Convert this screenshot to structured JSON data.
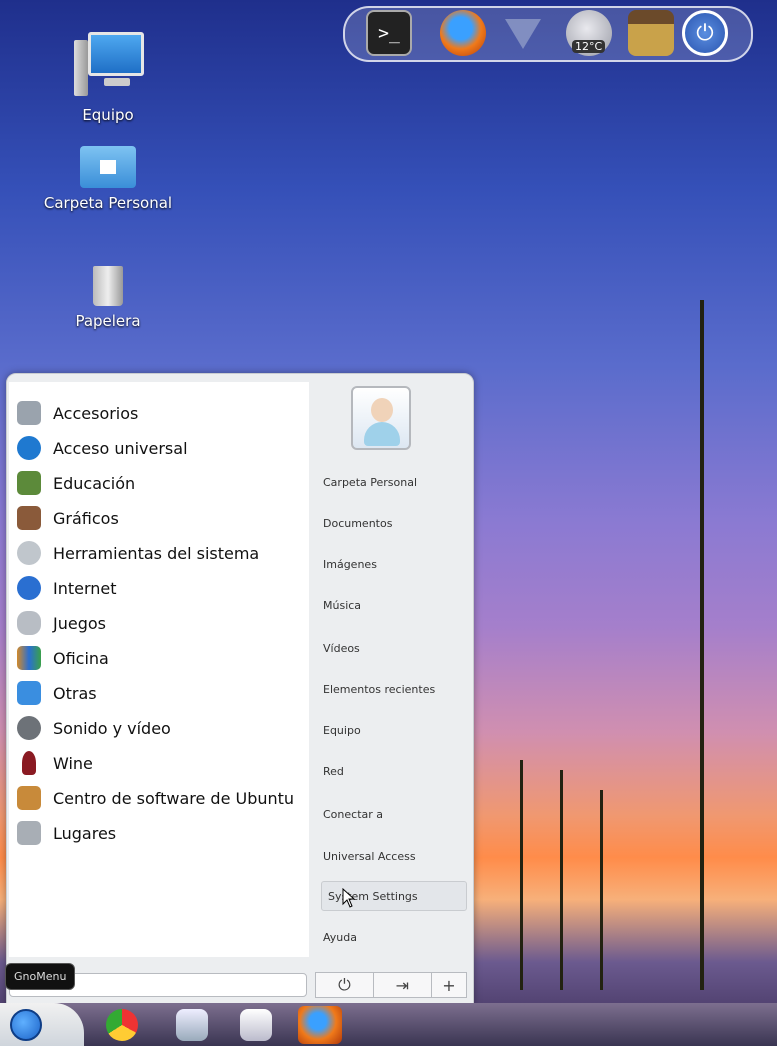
{
  "colors": {
    "menu_bg": "#eceef0",
    "category_bg": "#ffffff",
    "accent_blue": "#1c63c8",
    "taskbar_dark": "#3a3552"
  },
  "top_dock": {
    "weather_temp": "12°C",
    "icons": [
      "terminal-icon",
      "firefox-icon",
      "network-icon",
      "weather-icon",
      "archive-icon",
      "power-icon"
    ]
  },
  "desktop": {
    "icons": [
      {
        "label": "Equipo",
        "icon": "computer-icon"
      },
      {
        "label": "Carpeta Personal",
        "icon": "home-folder-icon"
      },
      {
        "label": "Papelera",
        "icon": "trash-icon"
      }
    ]
  },
  "menu": {
    "categories": [
      {
        "label": "Accesorios",
        "icon": "accessories-icon",
        "color": "#9aa3ad"
      },
      {
        "label": "Acceso universal",
        "icon": "universal-access-icon",
        "color": "#1f79d0"
      },
      {
        "label": "Educación",
        "icon": "education-icon",
        "color": "#5c8a3a"
      },
      {
        "label": "Gráficos",
        "icon": "graphics-icon",
        "color": "#8a5a3a"
      },
      {
        "label": "Herramientas del sistema",
        "icon": "system-tools-icon",
        "color": "#c0c6cc"
      },
      {
        "label": "Internet",
        "icon": "internet-icon",
        "color": "#2a6fd1"
      },
      {
        "label": "Juegos",
        "icon": "games-icon",
        "color": "#b8bdc4"
      },
      {
        "label": "Oficina",
        "icon": "office-icon",
        "color": "#d28a2a"
      },
      {
        "label": "Otras",
        "icon": "other-icon",
        "color": "#3a8ee0"
      },
      {
        "label": "Sonido y vídeo",
        "icon": "sound-video-icon",
        "color": "#6d7278"
      },
      {
        "label": "Wine",
        "icon": "wine-icon",
        "color": "#8a1a22"
      },
      {
        "label": "Centro de software de Ubuntu",
        "icon": "software-center-icon",
        "color": "#c88a3a"
      },
      {
        "label": "Lugares",
        "icon": "places-icon",
        "color": "#a8aeb5"
      }
    ],
    "places": [
      {
        "label": "Carpeta Personal"
      },
      {
        "label": "Documentos"
      },
      {
        "label": "Imágenes"
      },
      {
        "label": "Música"
      },
      {
        "label": "Vídeos"
      },
      {
        "label": "Elementos recientes"
      },
      {
        "label": "Equipo"
      },
      {
        "label": "Red"
      },
      {
        "label": "Conectar a"
      },
      {
        "label": "Universal Access"
      },
      {
        "label": "System Settings"
      },
      {
        "label": "Ayuda"
      }
    ],
    "search_placeholder": "",
    "tooltip": "GnoMenu",
    "buttons": {
      "power": "⏻",
      "logout": "⇥",
      "add": "+"
    }
  },
  "taskbar": {
    "icons": [
      "start-icon",
      "chrome-icon",
      "files-icon",
      "screenshot-icon",
      "firefox-icon"
    ]
  }
}
